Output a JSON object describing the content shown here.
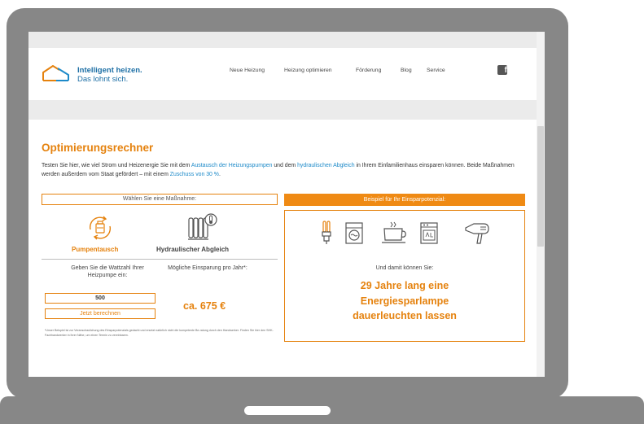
{
  "header": {
    "brand_line1": "Intelligent heizen.",
    "brand_line2": "Das lohnt sich.",
    "nav": [
      "Neue Heizung",
      "Heizung optimieren",
      "Förderung",
      "Blog",
      "Service"
    ],
    "facebook_glyph": "f"
  },
  "calculator": {
    "title": "Optimierungsrechner",
    "intro": {
      "part1": "Testen Sie hier, wie viel Strom und Heizenergie Sie mit dem ",
      "link1": "Austausch der Heizungspumpen",
      "part2": " und dem ",
      "link2": "hydraulischen Abgleich",
      "part3": " in Ihrem Einfamilienhaus einsparen können. Beide Maßnahmen werden außerdem vom Staat gefördert – mit einem ",
      "link3": "Zuschuss von 30 %",
      "part4": "."
    },
    "choose_label": "Wählen Sie eine Maßnahme:",
    "example_label": "Beispiel für Ihr Einsparpotenzial:",
    "options": [
      {
        "label": "Pumpentausch",
        "icon": "pump-icon",
        "selected": true
      },
      {
        "label": "Hydraulischer Abgleich",
        "icon": "radiator-icon",
        "selected": false
      }
    ],
    "wattage_question": "Geben Sie die Wattzahl Ihrer Heizpumpe ein:",
    "saving_question": "Mögliche Einsparung pro Jahr*:",
    "wattage_value": "500",
    "calculate_button": "Jetzt berechnen",
    "saving_value": "ca. 675 €",
    "footnote": "*Unser Beispiel ist zur Veranschaulichung des Einsparpotenzials gedacht und ersetzt natürlich nicht die kompetente Be-ratung durch den Handwerker. Finden Sie hier den SHK-Fachhandwerker in Ihrer Nähe, um einen Termin zu vereinbaren.",
    "appliances": [
      "energy-saving-lamp-icon",
      "washing-machine-icon",
      "coffee-cup-icon",
      "oven-icon",
      "hair-dryer-icon"
    ],
    "result_intro": "Und damit können Sie:",
    "result_lines": [
      "29 Jahre lang eine",
      "Energiesparlampe",
      "dauerleuchten lassen"
    ]
  },
  "colors": {
    "accent_orange": "#e5820e",
    "brand_blue": "#1d6fa5",
    "link_blue": "#1d8ac9",
    "laptop_gray": "#878787"
  }
}
